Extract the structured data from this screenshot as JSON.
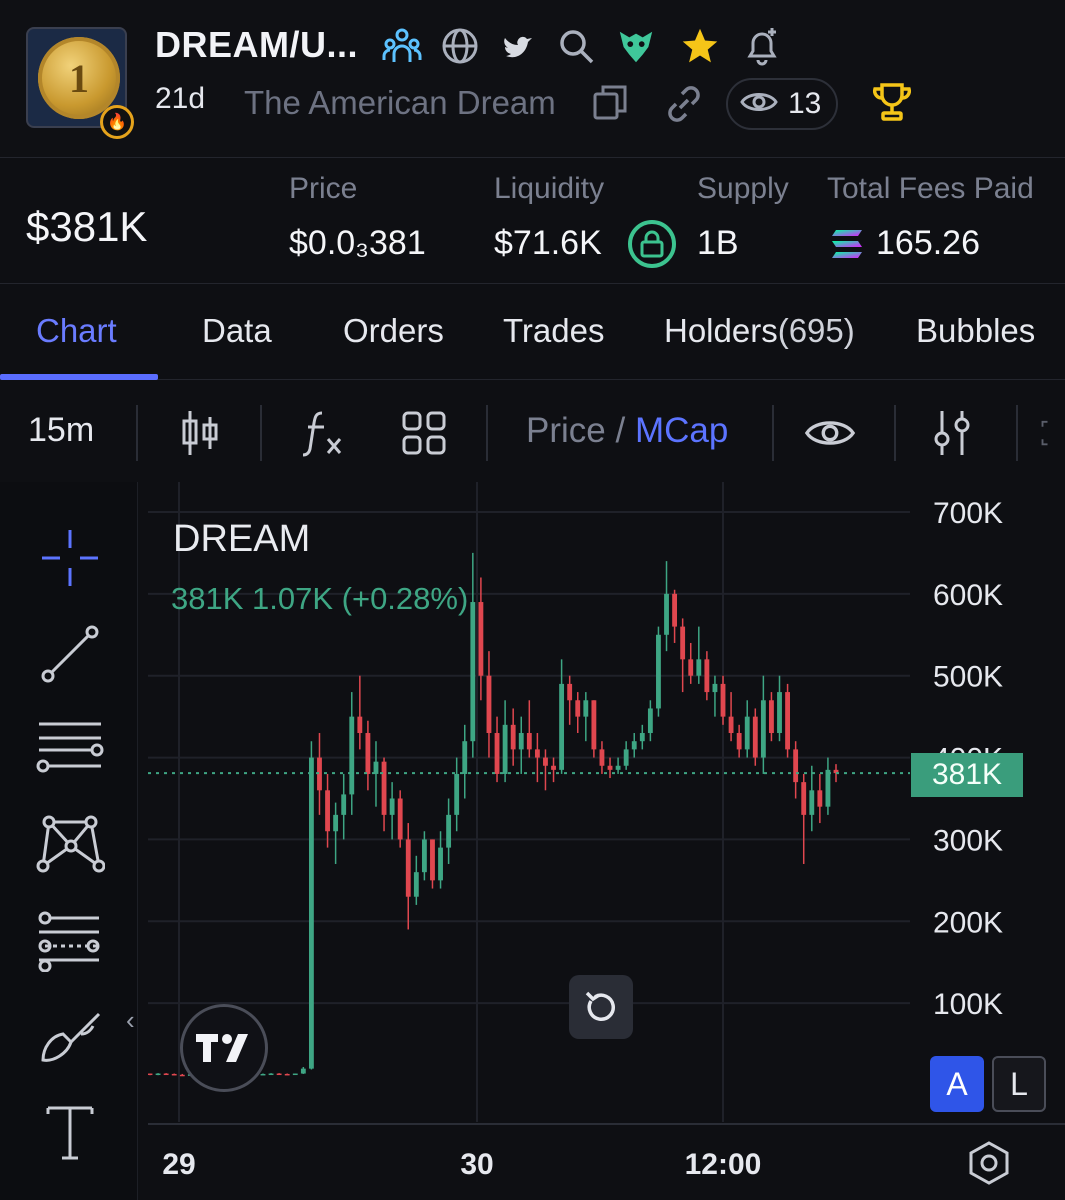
{
  "header": {
    "ticker": "DREAM/U...",
    "age": "21d",
    "full_name": "The American Dream",
    "watchers": "13",
    "icons": [
      "community-icon",
      "globe-icon",
      "twitter-bird-icon",
      "search-icon",
      "eagle-icon",
      "star-icon",
      "alert-bell-icon",
      "copy-icon",
      "link-icon",
      "eye-icon",
      "trophy-icon"
    ]
  },
  "stats": {
    "market_cap": "$381K",
    "price_label": "Price",
    "price_value": "$0.0₃381",
    "liquidity_label": "Liquidity",
    "liquidity_value": "$71.6K",
    "supply_label": "Supply",
    "supply_value": "1B",
    "fees_label": "Total Fees Paid",
    "fees_value": "165.26"
  },
  "tabs": [
    {
      "label": "Chart",
      "active": true
    },
    {
      "label": "Data"
    },
    {
      "label": "Orders"
    },
    {
      "label": "Trades"
    },
    {
      "label": "Holders",
      "count": "(695)"
    },
    {
      "label": "Bubbles"
    }
  ],
  "toolbar": {
    "interval": "15m",
    "price_label": "Price",
    "separator": " / ",
    "mcap_label": "MCap"
  },
  "chart": {
    "symbol": "DREAM",
    "ohlc_line": "381K  1.07K (+0.28%)",
    "current_price_tag": "381K",
    "scale_auto": "A",
    "scale_log": "L",
    "colors": {
      "up": "#3ea684",
      "down": "#e0474f",
      "grid": "#1f2129",
      "background": "#0e0f13"
    }
  },
  "chart_data": {
    "type": "candlestick",
    "title": "DREAM",
    "y_ticks": [
      "700K",
      "600K",
      "500K",
      "400K",
      "300K",
      "200K",
      "100K"
    ],
    "x_ticks": [
      "29",
      "30",
      "12:00"
    ],
    "ylim": [
      0,
      720000
    ],
    "last_value": 381000,
    "series": [
      {
        "values": [
          [
            14000,
            14000,
            12000,
            13000
          ],
          [
            13000,
            14500,
            12000,
            14000
          ],
          [
            14000,
            14500,
            13000,
            13500
          ],
          [
            13500,
            14000,
            12000,
            12500
          ],
          [
            12500,
            13500,
            11000,
            12000
          ],
          [
            12000,
            13500,
            11500,
            13000
          ],
          [
            13000,
            14000,
            12500,
            13500
          ],
          [
            13500,
            14000,
            12500,
            13000
          ],
          [
            13000,
            13500,
            11000,
            11500
          ],
          [
            11500,
            13000,
            11000,
            12500
          ],
          [
            12500,
            13500,
            12000,
            13000
          ],
          [
            13000,
            13500,
            12000,
            12500
          ],
          [
            12500,
            14000,
            12000,
            13500
          ],
          [
            13500,
            14000,
            12500,
            13000
          ],
          [
            13000,
            14000,
            12500,
            13500
          ],
          [
            13500,
            14500,
            13000,
            14000
          ],
          [
            14000,
            14500,
            13000,
            13500
          ],
          [
            13500,
            14000,
            12500,
            13000
          ],
          [
            13000,
            14000,
            12500,
            14000
          ],
          [
            14000,
            22000,
            13500,
            20000
          ],
          [
            20000,
            420000,
            19000,
            400000
          ],
          [
            400000,
            430000,
            330000,
            360000
          ],
          [
            360000,
            380000,
            290000,
            310000
          ],
          [
            310000,
            345000,
            270000,
            330000
          ],
          [
            330000,
            380000,
            300000,
            355000
          ],
          [
            355000,
            480000,
            330000,
            450000
          ],
          [
            450000,
            500000,
            410000,
            430000
          ],
          [
            430000,
            445000,
            360000,
            380000
          ],
          [
            380000,
            420000,
            340000,
            395000
          ],
          [
            395000,
            400000,
            310000,
            330000
          ],
          [
            330000,
            370000,
            300000,
            350000
          ],
          [
            350000,
            360000,
            290000,
            300000
          ],
          [
            300000,
            320000,
            190000,
            230000
          ],
          [
            230000,
            280000,
            220000,
            260000
          ],
          [
            260000,
            310000,
            250000,
            300000
          ],
          [
            300000,
            300000,
            240000,
            250000
          ],
          [
            250000,
            310000,
            240000,
            290000
          ],
          [
            290000,
            350000,
            270000,
            330000
          ],
          [
            330000,
            400000,
            310000,
            380000
          ],
          [
            380000,
            440000,
            350000,
            420000
          ],
          [
            420000,
            650000,
            400000,
            590000
          ],
          [
            590000,
            620000,
            470000,
            500000
          ],
          [
            500000,
            530000,
            400000,
            430000
          ],
          [
            430000,
            450000,
            370000,
            380000
          ],
          [
            380000,
            470000,
            370000,
            440000
          ],
          [
            440000,
            460000,
            390000,
            410000
          ],
          [
            410000,
            450000,
            380000,
            430000
          ],
          [
            430000,
            470000,
            400000,
            410000
          ],
          [
            410000,
            430000,
            370000,
            400000
          ],
          [
            400000,
            410000,
            360000,
            390000
          ],
          [
            390000,
            400000,
            370000,
            385000
          ],
          [
            385000,
            520000,
            380000,
            490000
          ],
          [
            490000,
            500000,
            440000,
            470000
          ],
          [
            470000,
            480000,
            430000,
            450000
          ],
          [
            450000,
            480000,
            420000,
            470000
          ],
          [
            470000,
            470000,
            400000,
            410000
          ],
          [
            410000,
            420000,
            380000,
            390000
          ],
          [
            390000,
            400000,
            375000,
            385000
          ],
          [
            385000,
            400000,
            380000,
            390000
          ],
          [
            390000,
            420000,
            385000,
            410000
          ],
          [
            410000,
            430000,
            400000,
            420000
          ],
          [
            420000,
            440000,
            410000,
            430000
          ],
          [
            430000,
            470000,
            420000,
            460000
          ],
          [
            460000,
            560000,
            450000,
            550000
          ],
          [
            550000,
            640000,
            530000,
            600000
          ],
          [
            600000,
            605000,
            540000,
            560000
          ],
          [
            560000,
            570000,
            480000,
            520000
          ],
          [
            520000,
            540000,
            490000,
            500000
          ],
          [
            500000,
            560000,
            490000,
            520000
          ],
          [
            520000,
            530000,
            470000,
            480000
          ],
          [
            480000,
            500000,
            450000,
            490000
          ],
          [
            490000,
            500000,
            440000,
            450000
          ],
          [
            450000,
            480000,
            420000,
            430000
          ],
          [
            430000,
            440000,
            400000,
            410000
          ],
          [
            410000,
            470000,
            400000,
            450000
          ],
          [
            450000,
            460000,
            390000,
            400000
          ],
          [
            400000,
            500000,
            380000,
            470000
          ],
          [
            470000,
            480000,
            420000,
            430000
          ],
          [
            430000,
            500000,
            420000,
            480000
          ],
          [
            480000,
            490000,
            400000,
            410000
          ],
          [
            410000,
            420000,
            350000,
            370000
          ],
          [
            370000,
            380000,
            270000,
            330000
          ],
          [
            330000,
            390000,
            310000,
            360000
          ],
          [
            360000,
            380000,
            320000,
            340000
          ],
          [
            340000,
            400000,
            330000,
            385000
          ],
          [
            385000,
            392000,
            370000,
            381000
          ]
        ]
      }
    ],
    "xlabel": "",
    "ylabel": ""
  }
}
